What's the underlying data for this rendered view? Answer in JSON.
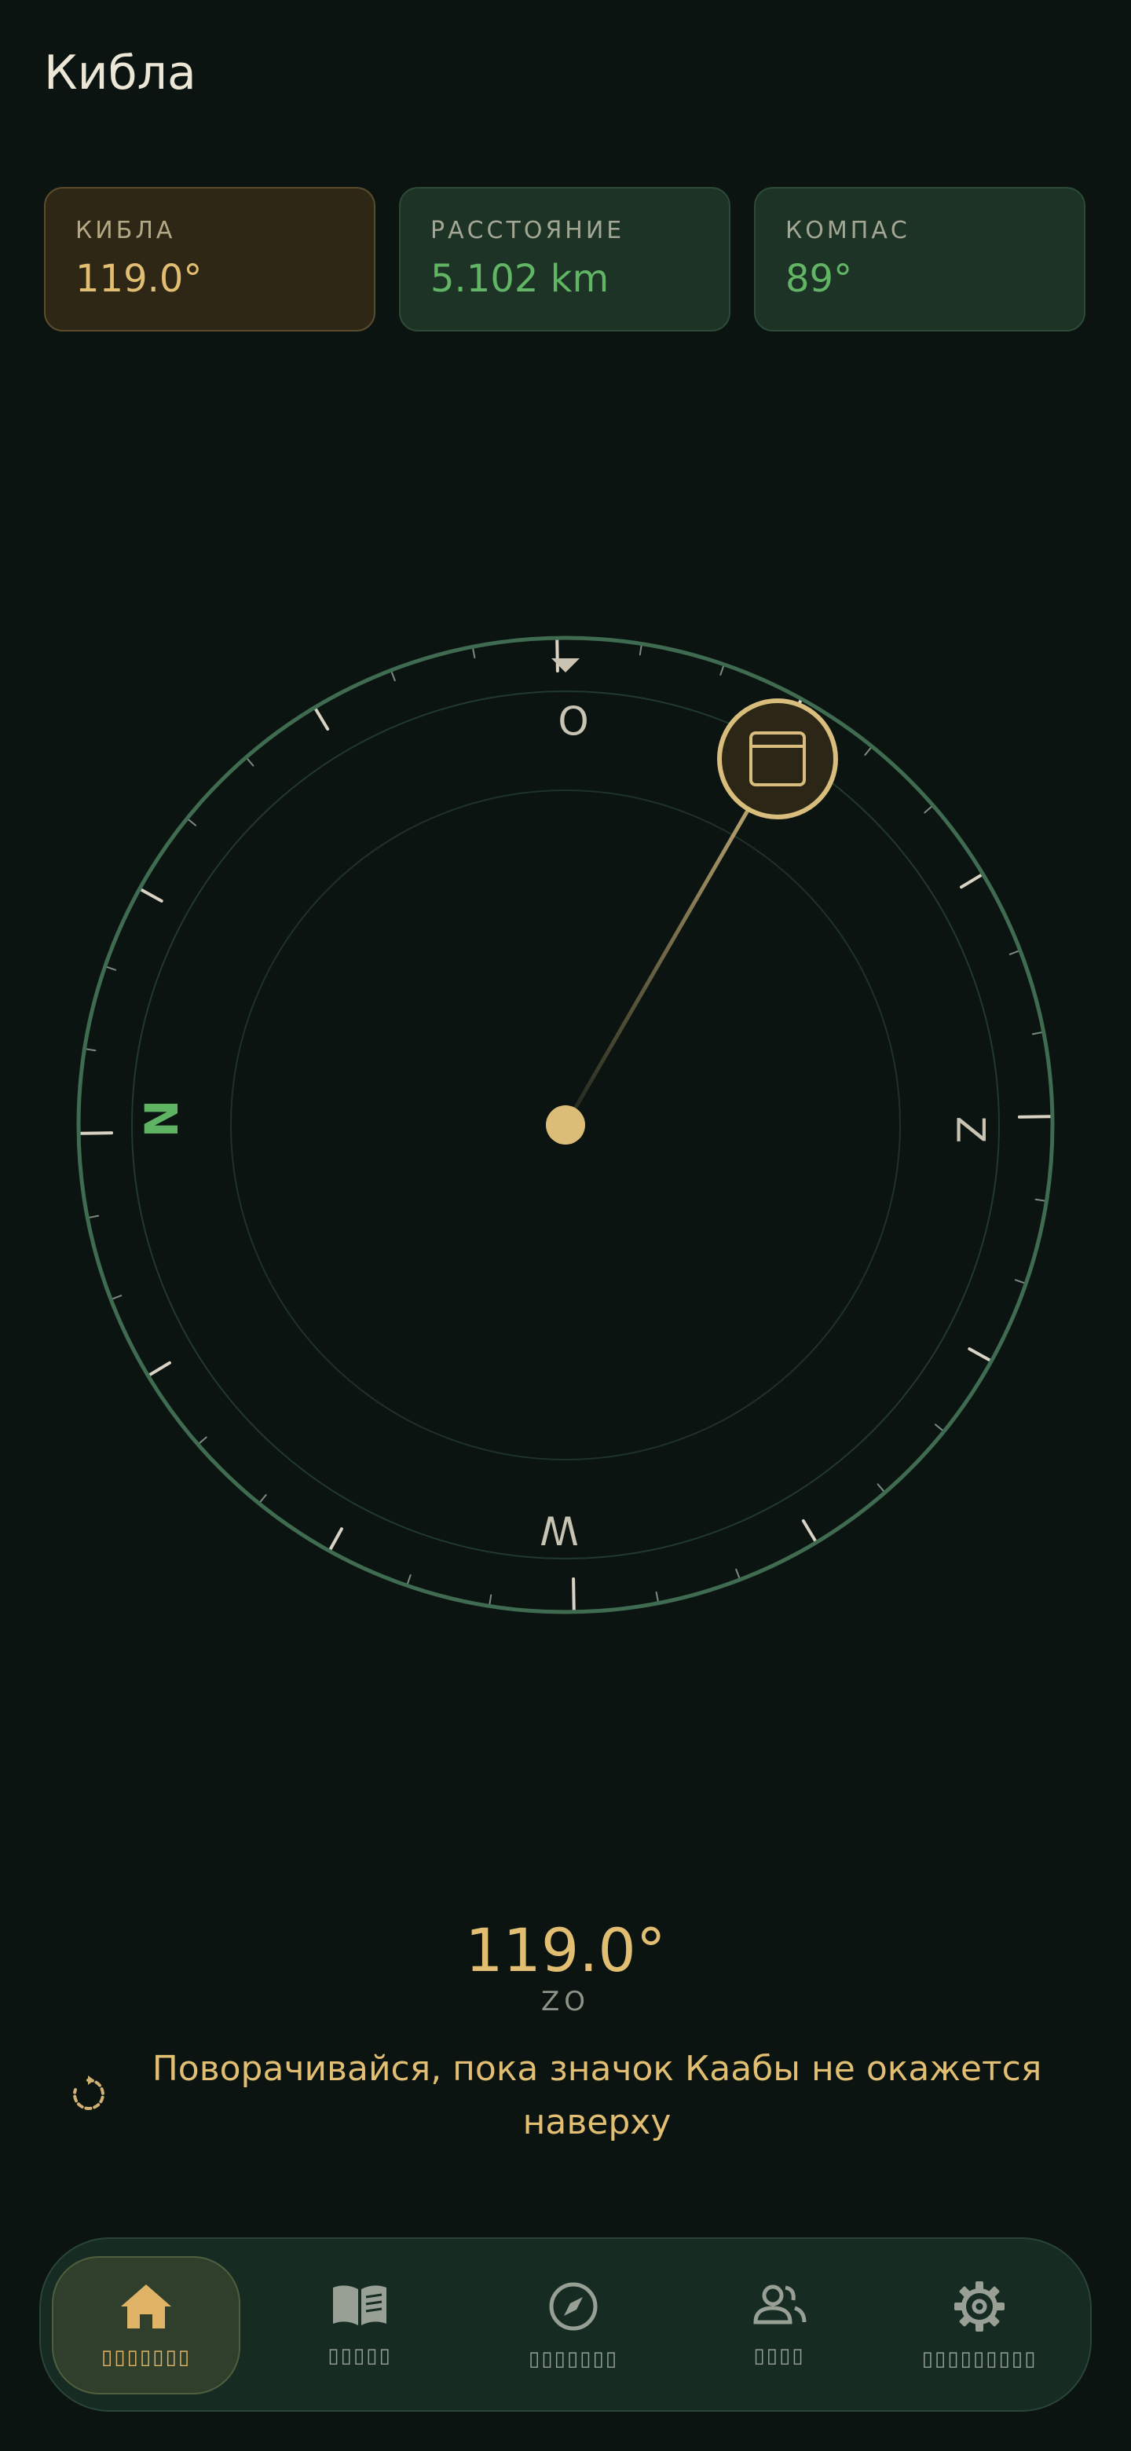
{
  "header": {
    "title": "Кибла"
  },
  "stats": [
    {
      "label": "КИБЛА",
      "value": "119.0°"
    },
    {
      "label": "РАССТОЯНИЕ",
      "value": "5.102 km"
    },
    {
      "label": "КОМПАС",
      "value": "89°"
    }
  ],
  "compass": {
    "heading_deg": 89,
    "qibla_deg": 119.0,
    "cardinals": {
      "top": "O",
      "right": "Z",
      "bottom": "W",
      "left": "N"
    },
    "colors": {
      "ring": "#3f6b50",
      "needle": "#cdb47a",
      "accent": "#e2be72",
      "north": "#5fb464"
    },
    "kaaba_icon": "kaaba-icon"
  },
  "readout": {
    "value": "119.0°",
    "direction": "ZO",
    "hint": "Поворачивайся, пока значок Каабы не окажется наверху"
  },
  "nav": {
    "items": [
      {
        "icon": "home-icon",
        "label": "▯▯▯▯▯▯▯",
        "active": true
      },
      {
        "icon": "book-icon",
        "label": "▯▯▯▯▯",
        "active": false
      },
      {
        "icon": "compass-icon",
        "label": "▯▯▯▯▯▯▯",
        "active": false
      },
      {
        "icon": "people-icon",
        "label": "▯▯▯▯",
        "active": false
      },
      {
        "icon": "gear-icon",
        "label": "▯▯▯▯▯▯▯▯▯",
        "active": false
      }
    ]
  }
}
